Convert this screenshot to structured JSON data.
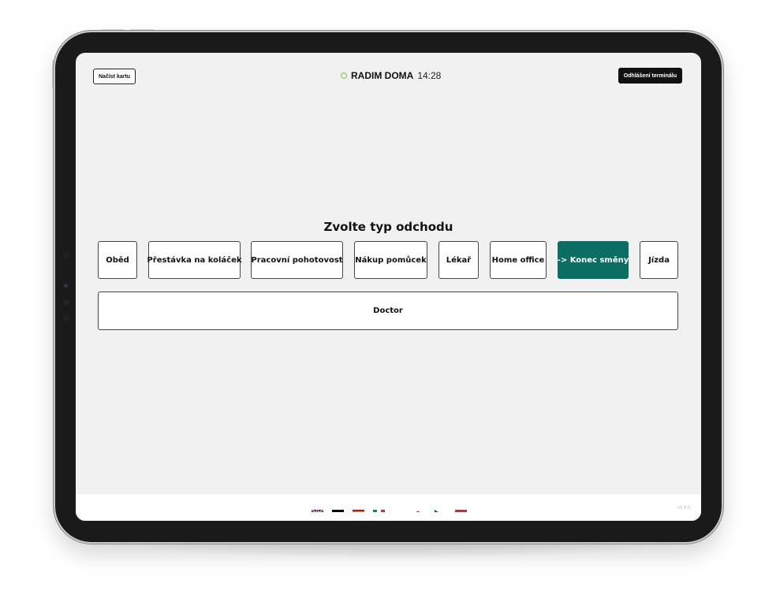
{
  "header": {
    "load_card_label": "Načíst kartu",
    "user_name": "RADIM DOMA",
    "time": "14:28",
    "logout_label": "Odhlášení terminálu"
  },
  "main": {
    "heading": "Zvolte typ odchodu",
    "choices": [
      {
        "label": "Oběd"
      },
      {
        "label": "Přestávka na koláček"
      },
      {
        "label": "Pracovní pohotovost"
      },
      {
        "label": "Nákup pomůcek"
      },
      {
        "label": "Lékař"
      },
      {
        "label": "Home office"
      },
      {
        "label": "-> Konec směny",
        "active": true
      },
      {
        "label": "Jízda"
      }
    ],
    "wide_choice": "Doctor"
  },
  "footer": {
    "flags": [
      "uk-flag-icon",
      "german-flag-icon",
      "spanish-flag-icon",
      "italian-flag-icon",
      "polish-flag-icon",
      "slovak-flag-icon",
      "czech-flag-icon",
      "hungarian-flag-icon"
    ],
    "version": "v3.4.0"
  },
  "colors": {
    "accent": "#0b6e63",
    "status_dot": "#7ac943",
    "screen_bg": "#f1f1f1"
  }
}
